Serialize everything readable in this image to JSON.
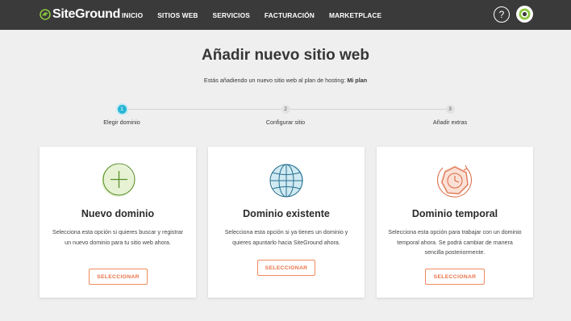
{
  "header": {
    "logo_text": "SiteGround",
    "nav": [
      "INICIO",
      "SITIOS WEB",
      "SERVICIOS",
      "FACTURACIÓN",
      "MARKETPLACE"
    ],
    "help_label": "?"
  },
  "page": {
    "title": "Añadir nuevo sitio web",
    "subtitle_prefix": "Estás añadiendo un nuevo sitio web al plan de hosting:",
    "plan_name": "Mi plan"
  },
  "steps": [
    {
      "number": "1",
      "label": "Elegir dominio",
      "state": "active"
    },
    {
      "number": "2",
      "label": "Configurar sitio",
      "state": "inactive"
    },
    {
      "number": "3",
      "label": "Añadir extras",
      "state": "inactive"
    }
  ],
  "cards": [
    {
      "icon": "plus-circle-icon",
      "title": "Nuevo dominio",
      "description": "Selecciona esta opción si quieres buscar y registrar un nuevo dominio para tu sitio web ahora.",
      "button": "SELECCIONAR"
    },
    {
      "icon": "globe-icon",
      "title": "Dominio existente",
      "description": "Selecciona esta opción si ya tienes un dominio y quieres apuntarlo hacia SiteGround ahora.",
      "button": "SELECCIONAR"
    },
    {
      "icon": "clock-icon",
      "title": "Dominio temporal",
      "description": "Selecciona esta opción para trabajar con un dominio temporal ahora. Se podrá cambiar de manera sencilla posteriormente.",
      "button": "SELECCIONAR"
    }
  ],
  "colors": {
    "topbar": "#3a3a3a",
    "accent_step": "#29b6d5",
    "button_accent": "#e8744a",
    "brand_green": "#8cc63f"
  }
}
